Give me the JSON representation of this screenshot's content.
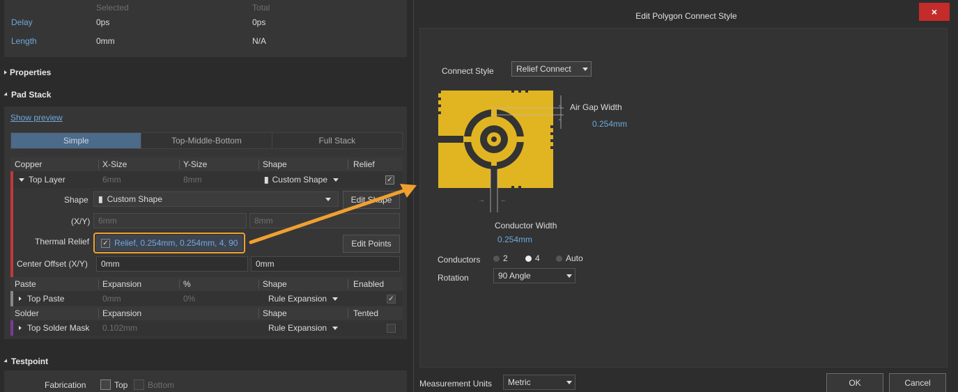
{
  "left": {
    "selection": {
      "col_selected": "Selected",
      "col_total": "Total",
      "rows": [
        {
          "label": "Delay",
          "selected": "0ps",
          "total": "0ps"
        },
        {
          "label": "Length",
          "selected": "0mm",
          "total": "N/A"
        }
      ]
    },
    "properties_label": "Properties",
    "pad_stack_label": "Pad Stack",
    "show_preview": "Show preview",
    "tabs": [
      "Simple",
      "Top-Middle-Bottom",
      "Full Stack"
    ],
    "copper_header": {
      "c1": "Copper",
      "c2": "X-Size",
      "c3": "Y-Size",
      "c4": "Shape",
      "c5": "Relief"
    },
    "top_layer": {
      "name": "Top Layer",
      "x": "6mm",
      "y": "8mm",
      "shape": "Custom Shape",
      "relief_check": "✓"
    },
    "shape_row": {
      "label": "Shape",
      "value": "Custom Shape",
      "button": "Edit Shape"
    },
    "xy_row": {
      "label": "(X/Y)",
      "x": "6mm",
      "y": "8mm"
    },
    "thermal_row": {
      "label": "Thermal Relief",
      "value": "Relief, 0.254mm, 0.254mm, 4, 90",
      "check": "✓",
      "button": "Edit Points"
    },
    "offset_row": {
      "label": "Center Offset (X/Y)",
      "x": "0mm",
      "y": "0mm"
    },
    "paste_header": {
      "c1": "Paste",
      "c2": "Expansion",
      "c3": "%",
      "c4": "Shape",
      "c5": "Enabled"
    },
    "top_paste": {
      "name": "Top Paste",
      "exp": "0mm",
      "pct": "0%",
      "shape": "Rule Expansion",
      "check": "✓"
    },
    "solder_header": {
      "c1": "Solder",
      "c2": "Expansion",
      "c4": "Shape",
      "c5": "Tented"
    },
    "top_solder": {
      "name": "Top Solder Mask",
      "exp": "0.102mm",
      "shape": "Rule Expansion"
    },
    "testpoint_label": "Testpoint",
    "fabrication": {
      "label": "Fabrication",
      "top": "Top",
      "bottom": "Bottom"
    }
  },
  "dialog": {
    "title": "Edit Polygon Connect Style",
    "close": "×",
    "connect_style_label": "Connect Style",
    "connect_style_value": "Relief Connect",
    "air_gap_label": "Air Gap Width",
    "air_gap_value": "0.254mm",
    "conductor_width_label": "Conductor Width",
    "conductor_width_value": "0.254mm",
    "conductors_label": "Conductors",
    "conductor_options": [
      "2",
      "4",
      "Auto"
    ],
    "conductors_selected": "4",
    "rotation_label": "Rotation",
    "rotation_value": "90 Angle",
    "measurement_label": "Measurement Units",
    "measurement_value": "Metric",
    "ok": "OK",
    "cancel": "Cancel"
  },
  "colors": {
    "copper_yellow": "#e1b522",
    "highlight_orange": "#f0a030",
    "dialog_blue": "#6fa8dc"
  }
}
